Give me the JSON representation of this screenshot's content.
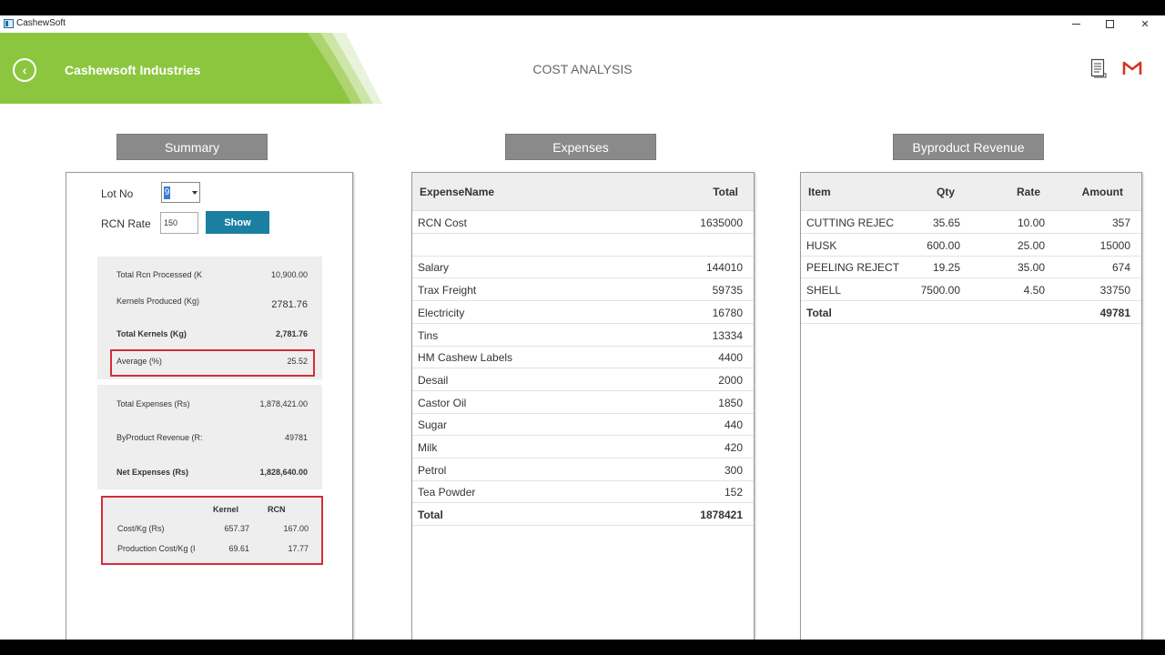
{
  "window": {
    "title": "CashewSoft"
  },
  "header": {
    "company": "Cashewsoft Industries",
    "title": "COST ANALYSIS",
    "brand_green": "#8cc63f",
    "icons": [
      "back-arrow-icon",
      "document-icon",
      "gmail-icon"
    ]
  },
  "summary": {
    "heading": "Summary",
    "lot_label": "Lot No",
    "lot_value": "9",
    "rcn_rate_label": "RCN Rate",
    "rcn_rate_value": "150",
    "show_label": "Show",
    "group1": [
      {
        "label": "Total Rcn Processed (K",
        "value": "10,900.00"
      },
      {
        "label": "Kernels Produced (Kg)",
        "value": "2781.76"
      },
      {
        "label": "Total Kernels (Kg)",
        "value": "2,781.76"
      },
      {
        "label": "Average (%)",
        "value": "25.52"
      }
    ],
    "group2": [
      {
        "label": "Total Expenses (Rs)",
        "value": "1,878,421.00"
      },
      {
        "label": "ByProduct Revenue (R:",
        "value": "49781"
      },
      {
        "label": "Net Expenses (Rs)",
        "value": "1,828,640.00"
      }
    ],
    "cost": {
      "col_kernel": "Kernel",
      "col_rcn": "RCN",
      "rows": [
        {
          "label": "Cost/Kg (Rs)",
          "kernel": "657.37",
          "rcn": "167.00"
        },
        {
          "label": "Production Cost/Kg (I",
          "kernel": "69.61",
          "rcn": "17.77"
        }
      ]
    }
  },
  "expenses": {
    "heading": "Expenses",
    "col_name": "ExpenseName",
    "col_total": "Total",
    "rows": [
      {
        "name": "RCN Cost",
        "total": "1635000"
      },
      {
        "name": "",
        "total": ""
      },
      {
        "name": "Salary",
        "total": "144010"
      },
      {
        "name": "Trax Freight",
        "total": "59735"
      },
      {
        "name": "Electricity",
        "total": "16780"
      },
      {
        "name": "Tins",
        "total": "13334"
      },
      {
        "name": "HM Cashew Labels",
        "total": "4400"
      },
      {
        "name": "Desail",
        "total": "2000"
      },
      {
        "name": "Castor Oil",
        "total": "1850"
      },
      {
        "name": "Sugar",
        "total": "440"
      },
      {
        "name": "Milk",
        "total": "420"
      },
      {
        "name": "Petrol",
        "total": "300"
      },
      {
        "name": "Tea Powder",
        "total": "152"
      },
      {
        "name": "Total",
        "total": "1878421"
      }
    ]
  },
  "byproduct": {
    "heading": "Byproduct Revenue",
    "col_item": "Item",
    "col_qty": "Qty",
    "col_rate": "Rate",
    "col_amount": "Amount",
    "rows": [
      {
        "item": "CUTTING REJEC",
        "qty": "35.65",
        "rate": "10.00",
        "amount": "357"
      },
      {
        "item": "HUSK",
        "qty": "600.00",
        "rate": "25.00",
        "amount": "15000"
      },
      {
        "item": "PEELING REJECT",
        "qty": "19.25",
        "rate": "35.00",
        "amount": "674"
      },
      {
        "item": "SHELL",
        "qty": "7500.00",
        "rate": "4.50",
        "amount": "33750"
      },
      {
        "item": "Total",
        "qty": "",
        "rate": "",
        "amount": "49781"
      }
    ]
  }
}
